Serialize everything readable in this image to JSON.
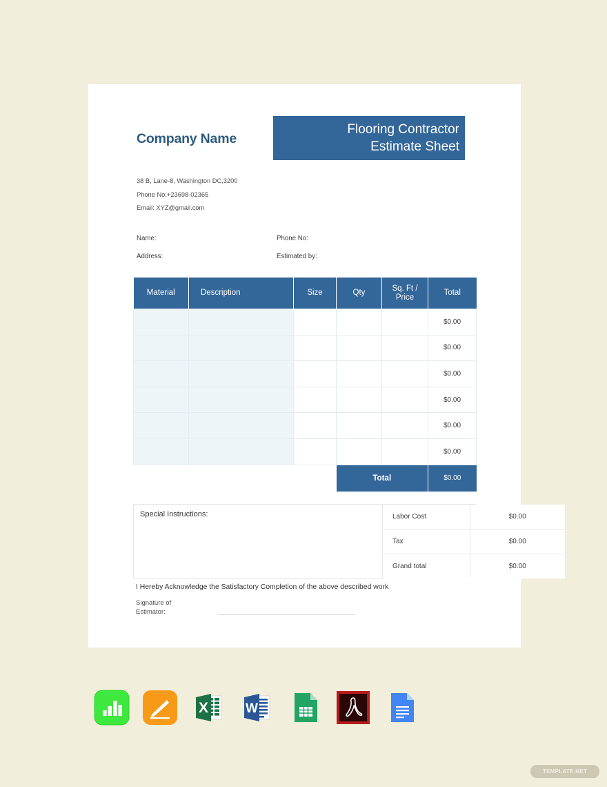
{
  "document": {
    "company_name": "Company Name",
    "title_line1": "Flooring Contractor",
    "title_line2": "Estimate Sheet",
    "address": "38 B, Lane-8, Washington DC,3200",
    "phone": "Phone No:+23698-02365",
    "email": "Email: XYZ@gmail.com"
  },
  "customer_fields": {
    "name_label": "Name:",
    "address_label": "Address:",
    "phone_label": "Phone No:",
    "estimated_by_label": "Estimated by:"
  },
  "items_table": {
    "headers": [
      "Material",
      "Description",
      "Size",
      "Qty",
      "Sq. Ft /",
      "Price",
      "Total"
    ],
    "header_material": "Material",
    "header_description": "Description",
    "header_size": "Size",
    "header_qty": "Qty",
    "header_sqft_line1": "Sq. Ft /",
    "header_sqft_line2": "Price",
    "header_total": "Total",
    "rows": [
      {
        "material": "",
        "description": "",
        "size": "",
        "qty": "",
        "sqft_price": "",
        "total": "$0.00"
      },
      {
        "material": "",
        "description": "",
        "size": "",
        "qty": "",
        "sqft_price": "",
        "total": "$0.00"
      },
      {
        "material": "",
        "description": "",
        "size": "",
        "qty": "",
        "sqft_price": "",
        "total": "$0.00"
      },
      {
        "material": "",
        "description": "",
        "size": "",
        "qty": "",
        "sqft_price": "",
        "total": "$0.00"
      },
      {
        "material": "",
        "description": "",
        "size": "",
        "qty": "",
        "sqft_price": "",
        "total": "$0.00"
      },
      {
        "material": "",
        "description": "",
        "size": "",
        "qty": "",
        "sqft_price": "",
        "total": "$0.00"
      }
    ],
    "total_label": "Total",
    "total_value": "$0.00"
  },
  "special_instructions": {
    "label": "Special Instructions:",
    "value": ""
  },
  "summary": {
    "rows": [
      {
        "label": "Labor Cost",
        "value": "$0.00"
      },
      {
        "label": "Tax",
        "value": "$0.00"
      },
      {
        "label": "Grand total",
        "value": "$0.00"
      }
    ]
  },
  "footer": {
    "acknowledgement": "I Hereby Acknowledge the Satisfactory Completion of the above described work",
    "signature_label_line1": "Signature of",
    "signature_label_line2": "Estimator:"
  },
  "format_icons": [
    {
      "name": "apple-numbers-icon",
      "label": "Apple Numbers"
    },
    {
      "name": "apple-pages-icon",
      "label": "Apple Pages"
    },
    {
      "name": "microsoft-excel-icon",
      "label": "Microsoft Excel"
    },
    {
      "name": "microsoft-word-icon",
      "label": "Microsoft Word"
    },
    {
      "name": "google-sheets-icon",
      "label": "Google Sheets"
    },
    {
      "name": "adobe-pdf-icon",
      "label": "Adobe PDF"
    },
    {
      "name": "google-docs-icon",
      "label": "Google Docs"
    }
  ],
  "watermark": {
    "text": "TEMPLATE.NET"
  },
  "colors": {
    "accent_blue": "#336699",
    "page_background": "#f1eedb",
    "row_tint": "#eef5f9",
    "company_name": "#2e5c80"
  }
}
